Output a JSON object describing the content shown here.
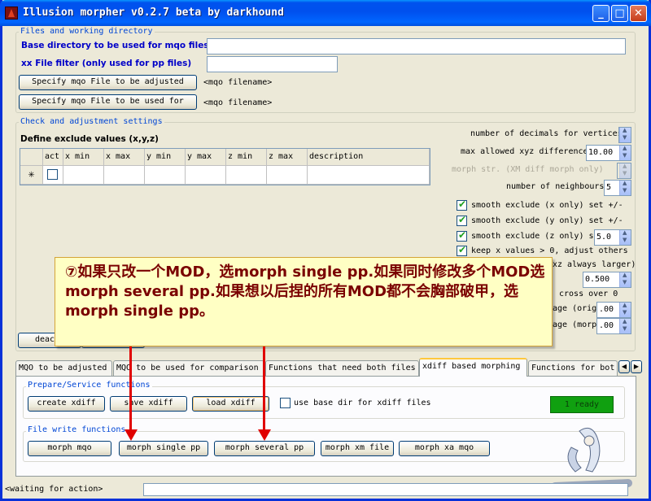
{
  "window": {
    "title": "Illusion morpher v0.2.7 beta by darkhound"
  },
  "files_group": {
    "legend": "Files and working directory",
    "base_dir_label": "Base directory to be used  for mqo files",
    "base_dir_value": "",
    "xx_filter_label": "xx File filter (only used for pp files)",
    "xx_filter_value": "",
    "specify_adjusted_button": "Specify mqo File to be adjusted",
    "adjusted_filename": "<mqo filename>",
    "specify_used_for_button": "Specify mqo File to be used for",
    "used_for_filename": "<mqo filename>"
  },
  "check_group": {
    "legend": "Check and adjustment settings",
    "define_exclude_label": "Define exclude values (x,y,z)",
    "columns": [
      "act",
      "x min",
      "x max",
      "y min",
      "y max",
      "z min",
      "z max",
      "description"
    ],
    "new_row_marker": "✳",
    "decimals_label": "number of decimals for vertices",
    "max_xyz_label": "max allowed xyz difference",
    "max_xyz_value": "10.00",
    "morph_str_label": "morph str. (XM diff morph only)",
    "neighbours_label": "number of neighbours",
    "neighbours_value": "5",
    "smooth_x_label": "smooth exclude (x only) set +/-",
    "smooth_x_checked": true,
    "smooth_y_label": "smooth exclude (y only) set +/-",
    "smooth_y_checked": true,
    "smooth_z_label": "smooth exclude (z only) se",
    "smooth_z_value": "5.0",
    "smooth_z_checked": true,
    "keep_x_label": "keep x values > 0, adjust others",
    "keep_x_checked": true,
    "xz_larger_label": "xz always larger)",
    "val_0500": "0.500",
    "cross_over_label": "cross over 0",
    "age_orig_label": "age (orig)",
    "age_orig_value": ".00",
    "age_morph_label": "age (morph",
    "age_morph_value": ".00",
    "deact_button": "deacti"
  },
  "tabs": [
    {
      "label": "MQO to be adjusted",
      "active": false
    },
    {
      "label": "MQO to be used for comparison",
      "active": false
    },
    {
      "label": "Functions that need both files",
      "active": false
    },
    {
      "label": "xdiff based morphing",
      "active": true
    },
    {
      "label": "Functions for bot",
      "active": false
    }
  ],
  "prepare_group": {
    "legend": "Prepare/Service functions",
    "create_button": "create xdiff",
    "save_button": "save xdiff",
    "load_button": "load xdiff",
    "use_base_dir_label": "use base dir for xdiff files",
    "use_base_dir_checked": false,
    "ready_text": "1 ready"
  },
  "write_group": {
    "legend": "File write functions",
    "morph_mqo": "morph mqo",
    "morph_single_pp": "morph single pp",
    "morph_several_pp": "morph several pp",
    "morph_xm_file": "morph xm file",
    "morph_xa_mqo": "morph xa mqo"
  },
  "note": {
    "text": "⑦如果只改一个MOD，选morph single pp.如果同时修改多个MOD选morph several pp.如果想以后捏的所有MOD都不会胸部破甲，选morph single pp。"
  },
  "status": {
    "text": "<waiting for action>"
  },
  "colors": {
    "title_bar": "#0053ee",
    "legend": "#0046d5",
    "note_bg": "#ffffc4",
    "note_text": "#7a0000",
    "arrow": "#e00000",
    "ready_bg": "#10a010"
  }
}
